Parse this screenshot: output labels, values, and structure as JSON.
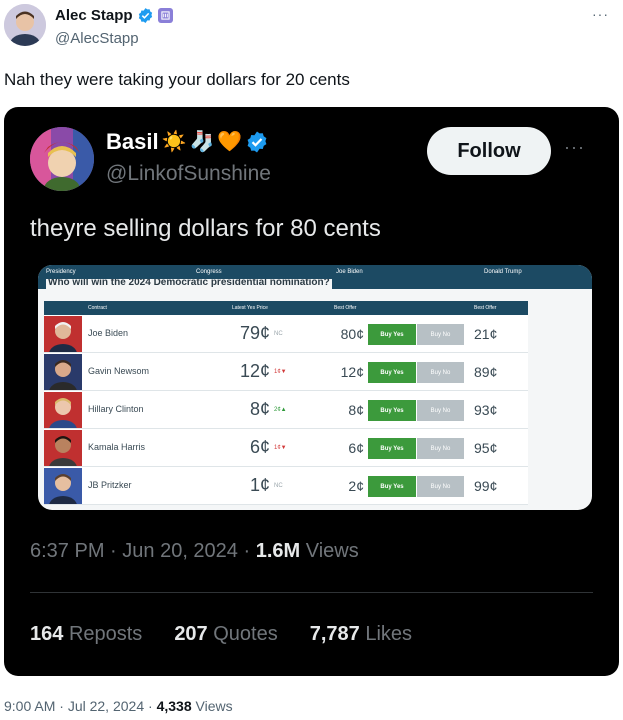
{
  "outer_tweet": {
    "name": "Alec Stapp",
    "handle": "@AlecStapp",
    "text": "Nah they were taking your dollars for 20 cents",
    "time": "9:00 AM",
    "date": "Jul 22, 2024",
    "views": "4,338",
    "views_label": "Views",
    "more": "···"
  },
  "quoted_tweet": {
    "name": "Basil",
    "name_emojis": [
      "☀️",
      "🧦",
      "🧡"
    ],
    "handle": "@LinkofSunshine",
    "follow_label": "Follow",
    "more": "···",
    "text": "theyre selling dollars for 80 cents",
    "time": "6:37 PM",
    "date": "Jun 20, 2024",
    "views": "1.6M",
    "views_label": "Views",
    "reposts": "164",
    "reposts_label": "Reposts",
    "quotes": "207",
    "quotes_label": "Quotes",
    "likes": "7,787",
    "likes_label": "Likes"
  },
  "market": {
    "top_labels": [
      "Presidency",
      "Congress",
      "Joe Biden",
      "Donald Trump"
    ],
    "question": "Who will win the 2024 Democratic presidential nomination?",
    "headers": {
      "contract": "Contract",
      "latest_yes": "Latest Yes Price",
      "best_offer": "Best Offer",
      "best_offer_no": "Best Offer"
    },
    "buy_yes": "Buy Yes",
    "buy_no": "Buy No",
    "rows": [
      {
        "name": "Joe Biden",
        "price": "79¢",
        "change": "NC",
        "change_color": "#9aa5ab",
        "yes_offer": "80¢",
        "no_offer": "21¢"
      },
      {
        "name": "Gavin Newsom",
        "price": "12¢",
        "change": "1¢▼",
        "change_color": "#d23a3a",
        "yes_offer": "12¢",
        "no_offer": "89¢"
      },
      {
        "name": "Hillary Clinton",
        "price": "8¢",
        "change": "2¢▲",
        "change_color": "#2f9a3a",
        "yes_offer": "8¢",
        "no_offer": "93¢"
      },
      {
        "name": "Kamala Harris",
        "price": "6¢",
        "change": "1¢▼",
        "change_color": "#d23a3a",
        "yes_offer": "6¢",
        "no_offer": "95¢"
      },
      {
        "name": "JB Pritzker",
        "price": "1¢",
        "change": "NC",
        "change_color": "#9aa5ab",
        "yes_offer": "2¢",
        "no_offer": "99¢"
      }
    ]
  },
  "colors": {
    "verified_blue": "#1d9bf0",
    "embed_bg": "#000000",
    "market_header": "#1c4a63",
    "buy_yes": "#3c9a3c",
    "buy_no": "#b7c0c5"
  }
}
